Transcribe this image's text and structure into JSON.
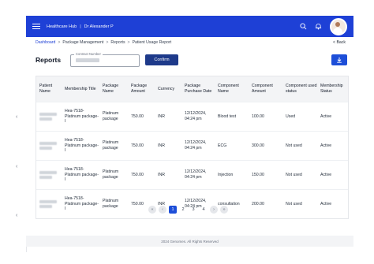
{
  "header": {
    "app_name": "Healthcare Hub",
    "separator": "|",
    "user_name": "Dr Alexander P"
  },
  "breadcrumb": {
    "items": [
      "Dashboard",
      "Package Management",
      "Reports",
      "Patient Usage Report"
    ],
    "separator": ">"
  },
  "back_label": "< Back",
  "page": {
    "title": "Reports",
    "contract_label": "Contract Number",
    "confirm_label": "Confirm"
  },
  "table": {
    "columns": [
      "Patient Name",
      "Membership Title",
      "Package Name",
      "Package Amount",
      "Currency",
      "Package Purchase Date",
      "Component Name",
      "Component Amount",
      "Component used status",
      "Membership Status"
    ],
    "rows": [
      {
        "membership": "Hea-7518-Platinum package-I",
        "package": "Platinum package",
        "amount": "750.00",
        "currency": "INR",
        "date": "12/12/2024, 04:24 pm",
        "component": "Blood test",
        "comp_amount": "100.00",
        "used": "Used",
        "status": "Active"
      },
      {
        "membership": "Hea-7518-Platinum package-I",
        "package": "Platinum package",
        "amount": "750.00",
        "currency": "INR",
        "date": "12/12/2024, 04:24 pm",
        "component": "ECG",
        "comp_amount": "300.00",
        "used": "Not used",
        "status": "Active"
      },
      {
        "membership": "Hea-7518-Platinum package-I",
        "package": "Platinum package",
        "amount": "750.00",
        "currency": "INR",
        "date": "12/12/2024, 04:24 pm",
        "component": "Injection",
        "comp_amount": "150.00",
        "used": "Not used",
        "status": "Active"
      },
      {
        "membership": "Hea-7518-Platinum package-I",
        "package": "Platinum package",
        "amount": "750.00",
        "currency": "INR",
        "date": "12/12/2024, 04:24 pm",
        "component": "consultation",
        "comp_amount": "200.00",
        "used": "Not used",
        "status": "Active"
      }
    ]
  },
  "pagination": {
    "first": "«",
    "prev": "‹",
    "pages": [
      "1",
      "2",
      "3",
      "4"
    ],
    "next": "›",
    "last": "»",
    "current": "1"
  },
  "footer": "2024 Genomes. All Rights Reserved",
  "colors": {
    "primary": "#1e40d6",
    "confirm": "#1e3a8a",
    "header_bg": "#f3f4f6"
  },
  "icons": [
    "menu-icon",
    "search-icon",
    "bell-icon",
    "avatar",
    "download-icon"
  ]
}
